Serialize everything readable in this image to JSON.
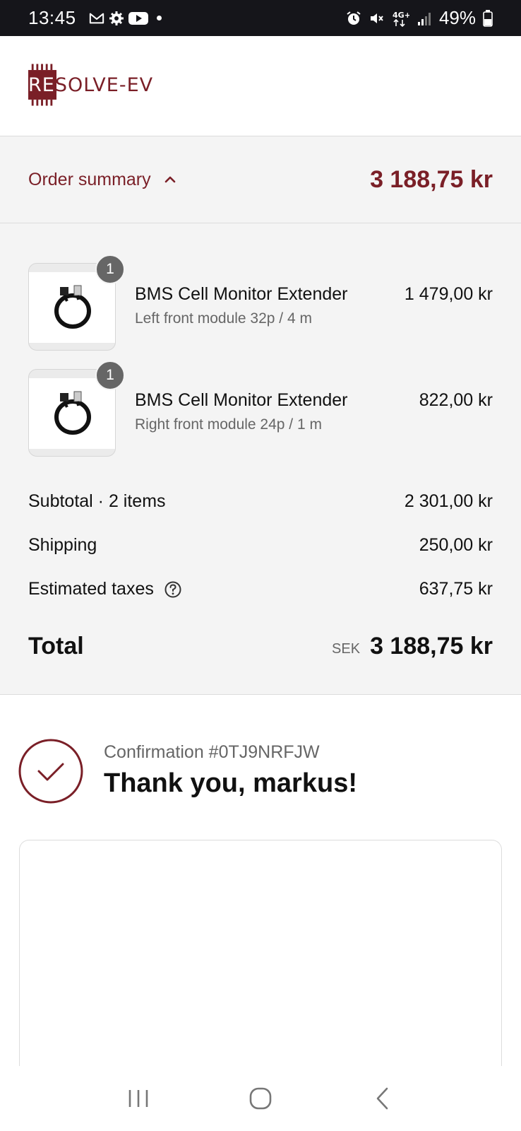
{
  "status_bar": {
    "time": "13:45",
    "battery": "49%",
    "left_icons": [
      "gmail-icon",
      "settings-icon",
      "youtube-icon",
      "dot-icon"
    ],
    "right_icons": [
      "alarm-icon",
      "mute-icon",
      "4g-icon",
      "signal-icon",
      "battery-icon"
    ]
  },
  "header": {
    "logo_prefix": "RE",
    "logo_rest": "SOLVE-EV"
  },
  "summary_bar": {
    "label": "Order summary",
    "total": "3 188,75 kr"
  },
  "items": [
    {
      "quantity": "1",
      "name": "BMS Cell Monitor Extender",
      "variant": "Left front module 32p / 4 m",
      "price": "1 479,00 kr"
    },
    {
      "quantity": "1",
      "name": "BMS Cell Monitor Extender",
      "variant": "Right front module 24p / 1 m",
      "price": "822,00 kr"
    }
  ],
  "totals": {
    "subtotal_label": "Subtotal · 2 items",
    "subtotal_value": "2 301,00 kr",
    "shipping_label": "Shipping",
    "shipping_value": "250,00 kr",
    "taxes_label": "Estimated taxes",
    "taxes_value": "637,75 kr",
    "total_label": "Total",
    "total_currency": "SEK",
    "total_value": "3 188,75 kr"
  },
  "confirmation": {
    "number": "Confirmation #0TJ9NRFJW",
    "thanks": "Thank you, markus!"
  },
  "colors": {
    "brand": "#7a1f27",
    "panel_bg": "#f4f4f4",
    "status_bar_bg": "#15151a"
  }
}
